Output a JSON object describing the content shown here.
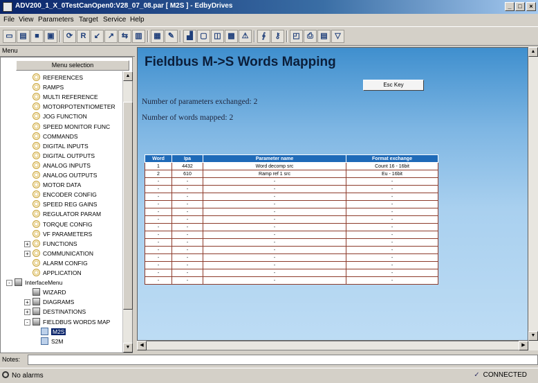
{
  "window": {
    "title": "ADV200_1_X_0TestCanOpen0:V28_07_08.par [ M2S ] - EdbyDrives",
    "controls": [
      "_",
      "□",
      "×"
    ]
  },
  "menubar": [
    "File",
    "View",
    "Parameters",
    "Target",
    "Service",
    "Help"
  ],
  "toolbar": {
    "buttons": [
      "new",
      "open",
      "save",
      "save-as",
      "refresh",
      "R",
      "read",
      "write",
      "compare",
      "database",
      "grid",
      "tools",
      "chart",
      "monitor",
      "scope",
      "alarm",
      "warning",
      "link",
      "key",
      "print-preview",
      "print",
      "options",
      "filter"
    ]
  },
  "menu_panel": {
    "header": "Menu",
    "selection_title": "Menu selection",
    "items": [
      {
        "label": "REFERENCES",
        "icon": "param",
        "level": 1
      },
      {
        "label": "RAMPS",
        "icon": "param",
        "level": 1
      },
      {
        "label": "MULTI REFERENCE",
        "icon": "param",
        "level": 1
      },
      {
        "label": "MOTORPOTENTIOMETER",
        "icon": "param",
        "level": 1
      },
      {
        "label": "JOG FUNCTION",
        "icon": "param",
        "level": 1
      },
      {
        "label": "SPEED MONITOR FUNC",
        "icon": "param",
        "level": 1
      },
      {
        "label": "COMMANDS",
        "icon": "param",
        "level": 1
      },
      {
        "label": "DIGITAL INPUTS",
        "icon": "param",
        "level": 1
      },
      {
        "label": "DIGITAL OUTPUTS",
        "icon": "param",
        "level": 1
      },
      {
        "label": "ANALOG INPUTS",
        "icon": "param",
        "level": 1
      },
      {
        "label": "ANALOG OUTPUTS",
        "icon": "param",
        "level": 1
      },
      {
        "label": "MOTOR DATA",
        "icon": "param",
        "level": 1
      },
      {
        "label": "ENCODER CONFIG",
        "icon": "param",
        "level": 1
      },
      {
        "label": "SPEED REG GAINS",
        "icon": "param",
        "level": 1
      },
      {
        "label": "REGULATOR PARAM",
        "icon": "param",
        "level": 1
      },
      {
        "label": "TORQUE CONFIG",
        "icon": "param",
        "level": 1
      },
      {
        "label": "VF PARAMETERS",
        "icon": "param",
        "level": 1
      },
      {
        "label": "FUNCTIONS",
        "icon": "param",
        "level": 1,
        "expander": "+"
      },
      {
        "label": "COMMUNICATION",
        "icon": "param",
        "level": 1,
        "expander": "+"
      },
      {
        "label": "ALARM CONFIG",
        "icon": "param",
        "level": 1
      },
      {
        "label": "APPLICATION",
        "icon": "param",
        "level": 1
      },
      {
        "label": "InterfaceMenu",
        "icon": "folder",
        "level": 0,
        "expander": "-"
      },
      {
        "label": "WIZARD",
        "icon": "folder",
        "level": 1
      },
      {
        "label": "DIAGRAMS",
        "icon": "folder",
        "level": 1,
        "expander": "+"
      },
      {
        "label": "DESTINATIONS",
        "icon": "folder",
        "level": 1,
        "expander": "+"
      },
      {
        "label": "FIELDBUS WORDS MAP",
        "icon": "folder",
        "level": 1,
        "expander": "-"
      },
      {
        "label": "M2S",
        "icon": "doc",
        "level": 2,
        "selected": true
      },
      {
        "label": "S2M",
        "icon": "doc",
        "level": 2
      }
    ]
  },
  "page": {
    "title": "Fieldbus M->S Words Mapping",
    "esc_label": "Esc Key",
    "params_exchanged_label": "Number of parameters exchanged:",
    "params_exchanged_value": "2",
    "words_mapped_label": "Number of words mapped:",
    "words_mapped_value": "2"
  },
  "table": {
    "headers": [
      "Word",
      "Ipa",
      "Parameter name",
      "Format exchange"
    ],
    "rows": [
      [
        "1",
        "4432",
        "Word decomp src",
        "Count 16 - 16bit"
      ],
      [
        "2",
        "610",
        "Ramp ref 1 src",
        "Eu - 16bit"
      ],
      [
        "-",
        "-",
        "-",
        "-"
      ],
      [
        "-",
        "-",
        "-",
        "-"
      ],
      [
        "-",
        "-",
        "-",
        "-"
      ],
      [
        "-",
        "-",
        "-",
        "-"
      ],
      [
        "-",
        "-",
        "-",
        "-"
      ],
      [
        "-",
        "-",
        "-",
        "-"
      ],
      [
        "-",
        "-",
        "-",
        "-"
      ],
      [
        "-",
        "-",
        "-",
        "-"
      ],
      [
        "-",
        "-",
        "-",
        "-"
      ],
      [
        "-",
        "-",
        "-",
        "-"
      ],
      [
        "-",
        "-",
        "-",
        "-"
      ],
      [
        "-",
        "-",
        "-",
        "-"
      ],
      [
        "-",
        "-",
        "-",
        "-"
      ],
      [
        "-",
        "-",
        "-",
        "-"
      ]
    ]
  },
  "notes_label": "Notes:",
  "status": {
    "alarms": "No alarms",
    "connection": "CONNECTED"
  },
  "colors": {
    "titlebar": "#0a246a",
    "table_header": "#1e6ab8",
    "table_border": "#8c3a2a",
    "page_bg_top": "#3f8fce"
  }
}
